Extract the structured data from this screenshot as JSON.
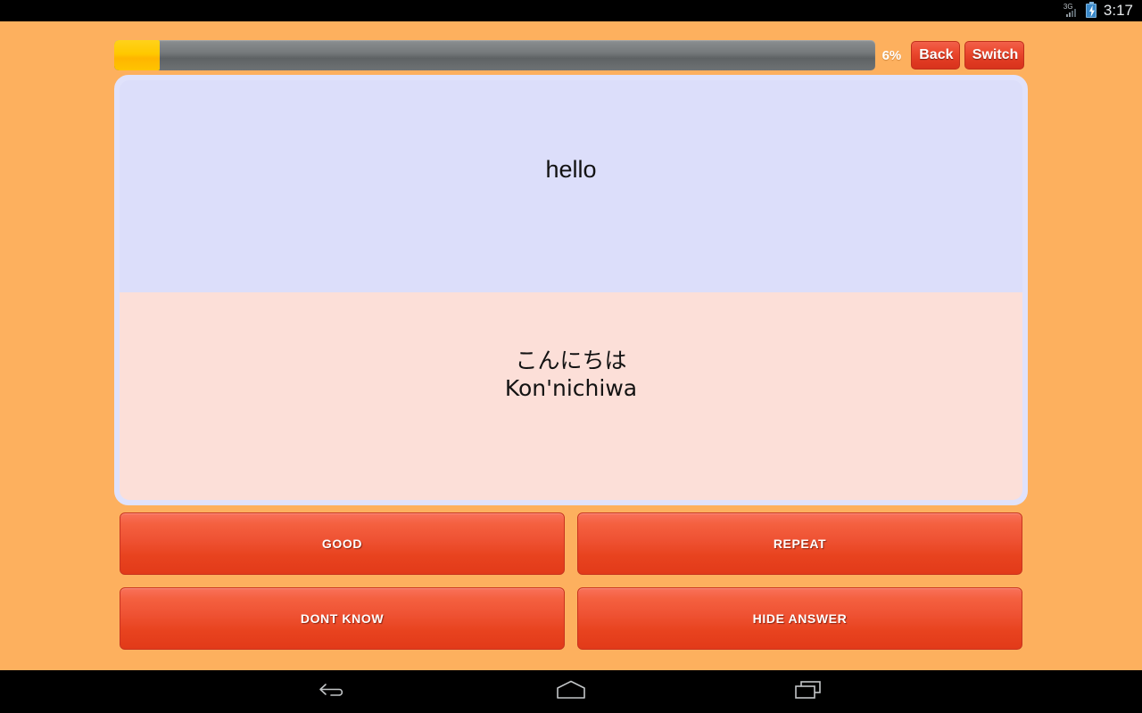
{
  "status_bar": {
    "network_label": "3G",
    "network_icon": "signal-bars-icon",
    "battery_icon": "battery-charging-icon",
    "clock": "3:17"
  },
  "header": {
    "progress_percent_label": "6%",
    "progress_percent_value": 6,
    "progress_fill_color": "#ffc800",
    "progress_track_color": "#6e7274",
    "back_label": "Back",
    "switch_label": "Switch"
  },
  "card": {
    "question": "hello",
    "answer": "こんにちは\nKon'nichiwa",
    "question_bg": "#dcdefa",
    "answer_bg": "#fcdfd8"
  },
  "actions": {
    "good_label": "GOOD",
    "repeat_label": "REPEAT",
    "dont_know_label": "DONT KNOW",
    "hide_answer_label": "HIDE ANSWER",
    "accent_color": "#ec4b31"
  },
  "nav_bar": {
    "back_icon": "back-arrow-icon",
    "home_icon": "home-icon",
    "recents_icon": "recent-apps-icon"
  },
  "theme": {
    "background_color": "#fdb05e",
    "system_bar_color": "#000000"
  }
}
